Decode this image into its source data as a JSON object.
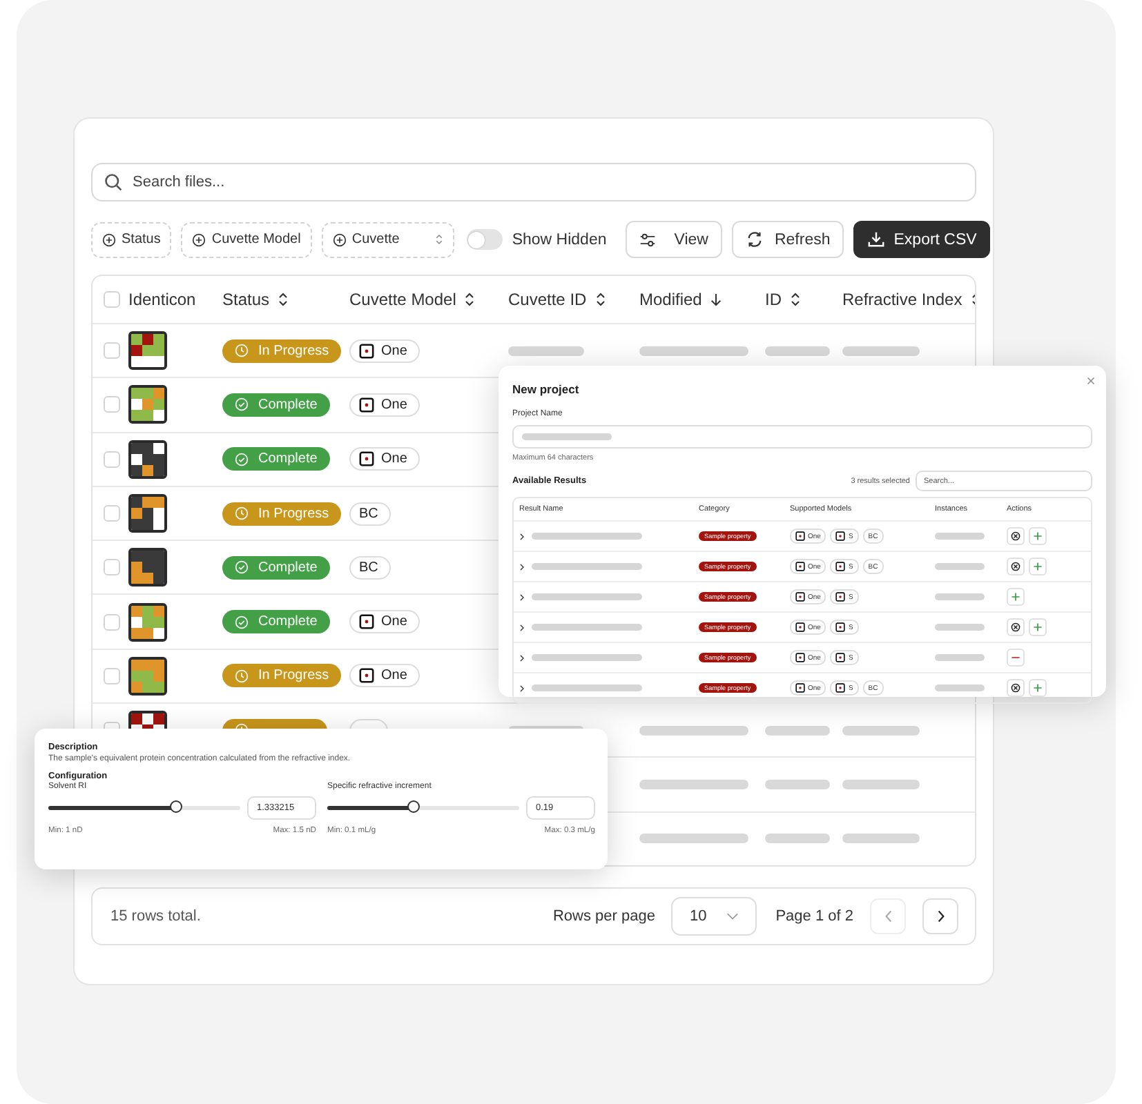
{
  "search": {
    "placeholder": "Search files..."
  },
  "filters": [
    {
      "label": "Status",
      "kind": "add"
    },
    {
      "label": "Cuvette Model",
      "kind": "add"
    },
    {
      "label": "Cuvette",
      "kind": "select"
    }
  ],
  "show_hidden": {
    "label": "Show Hidden",
    "on": false
  },
  "actions": [
    {
      "label": "View",
      "kind": "view"
    },
    {
      "label": "Refresh",
      "kind": "refresh"
    },
    {
      "label": "Export CSV",
      "kind": "export"
    }
  ],
  "table": {
    "select_all": {
      "checked": false
    },
    "columns": [
      {
        "label": "Identicon",
        "sortable": false
      },
      {
        "label": "Status",
        "sortable": true,
        "sorted_descending": false
      },
      {
        "label": "Cuvette Model",
        "sortable": true,
        "sorted_descending": false
      },
      {
        "label": "Cuvette ID",
        "sortable": true,
        "sorted_descending": false
      },
      {
        "label": "Modified",
        "sortable": true,
        "sorted_descending": true
      },
      {
        "label": "ID",
        "sortable": true,
        "sorted_descending": false
      },
      {
        "label": "Refractive Index",
        "sortable": true,
        "sorted_descending": false
      }
    ],
    "rows": [
      {
        "checked": false,
        "status": {
          "label": "In Progress",
          "kind": "in_progress"
        },
        "model": {
          "label": "One",
          "icon": true
        },
        "loading": {
          "cuvette_id": true,
          "modified": true,
          "id": true,
          "refractive_index": true
        }
      },
      {
        "checked": false,
        "status": {
          "label": "Complete",
          "kind": "complete"
        },
        "model": {
          "label": "One",
          "icon": true
        }
      },
      {
        "checked": false,
        "status": {
          "label": "Complete",
          "kind": "complete"
        },
        "model": {
          "label": "One",
          "icon": true
        }
      },
      {
        "checked": false,
        "status": {
          "label": "In Progress",
          "kind": "in_progress"
        },
        "model": {
          "label": "BC",
          "icon": false
        }
      },
      {
        "checked": false,
        "status": {
          "label": "Complete",
          "kind": "complete"
        },
        "model": {
          "label": "BC",
          "icon": false
        }
      },
      {
        "checked": false,
        "status": {
          "label": "Complete",
          "kind": "complete"
        },
        "model": {
          "label": "One",
          "icon": true
        }
      },
      {
        "checked": false,
        "status": {
          "label": "In Progress",
          "kind": "in_progress"
        },
        "model": {
          "label": "One",
          "icon": true
        }
      },
      {
        "checked": false,
        "status": {
          "kind": "in_progress"
        },
        "model": {},
        "loading": {
          "cuvette_id": true,
          "modified": true,
          "id": true,
          "refractive_index": true
        }
      },
      {
        "loading": {
          "modified": true,
          "id": true,
          "refractive_index": true
        }
      },
      {
        "loading": {
          "modified": true,
          "id": true,
          "refractive_index": true
        }
      }
    ]
  },
  "footer": {
    "total": "15 rows total.",
    "rows_per_page_label": "Rows per page",
    "rows_per_page": "10",
    "page": "Page 1 of 2",
    "prev_disabled": true,
    "next_disabled": false
  },
  "dialog": {
    "title": "New project",
    "name_label": "Project Name",
    "hint": "Maximum 64 characters",
    "results_title": "Available Results",
    "selected_count": "3 results selected",
    "search": {
      "placeholder": "Search..."
    },
    "columns": [
      "Result Name",
      "Category",
      "Supported Models",
      "Instances",
      "Actions"
    ],
    "rows": [
      {
        "category": "Sample property",
        "models": [
          {
            "label": "One",
            "icon": true
          },
          {
            "label": "S",
            "icon": true
          },
          {
            "label": "BC",
            "icon": false
          }
        ],
        "actions": [
          {
            "kind": "clear"
          },
          {
            "kind": "add"
          }
        ]
      },
      {
        "category": "Sample property",
        "models": [
          {
            "label": "One",
            "icon": true
          },
          {
            "label": "S",
            "icon": true
          },
          {
            "label": "BC",
            "icon": false
          }
        ],
        "actions": [
          {
            "kind": "clear"
          },
          {
            "kind": "add"
          }
        ]
      },
      {
        "category": "Sample property",
        "models": [
          {
            "label": "One",
            "icon": true
          },
          {
            "label": "S",
            "icon": true
          }
        ],
        "actions": [
          {
            "kind": "add"
          }
        ]
      },
      {
        "category": "Sample property",
        "models": [
          {
            "label": "One",
            "icon": true
          },
          {
            "label": "S",
            "icon": true
          }
        ],
        "actions": [
          {
            "kind": "clear"
          },
          {
            "kind": "add"
          }
        ]
      },
      {
        "category": "Sample property",
        "models": [
          {
            "label": "One",
            "icon": true
          },
          {
            "label": "S",
            "icon": true
          }
        ],
        "actions": [
          {
            "kind": "remove"
          }
        ]
      },
      {
        "category": "Sample property",
        "models": [
          {
            "label": "One",
            "icon": true
          },
          {
            "label": "S",
            "icon": true
          },
          {
            "label": "BC",
            "icon": false
          }
        ],
        "actions": [
          {
            "kind": "clear"
          },
          {
            "kind": "add"
          }
        ]
      }
    ]
  },
  "config": {
    "description_title": "Description",
    "description": "The sample's equivalent protein concentration calculated from the refractive index.",
    "title": "Configuration",
    "sliders": [
      {
        "label": "Solvent RI",
        "level": 0.67,
        "value": "1.333215",
        "min": "Min: 1 nD",
        "max": "Max: 1.5 nD"
      },
      {
        "label": "Specific refractive increment",
        "level": 0.45,
        "value": "0.19",
        "min": "Min: 0.1 mL/g",
        "max": "Max: 0.3 mL/g"
      }
    ]
  }
}
